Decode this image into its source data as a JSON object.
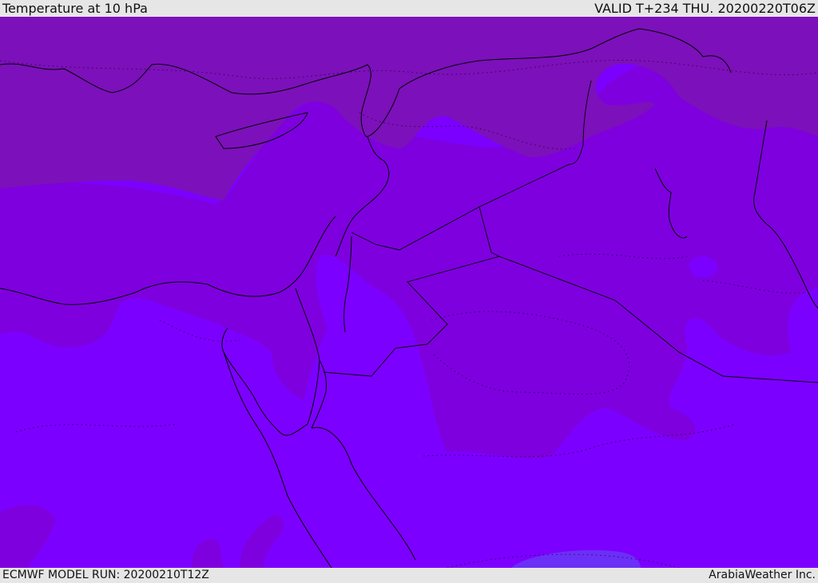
{
  "header": {
    "title": "Temperature at 10 hPa",
    "valid": "VALID T+234 THU. 20200220T06Z"
  },
  "footer": {
    "model_run": "ECMWF MODEL RUN: 20200210T12Z",
    "credit": "ArabiaWeather Inc."
  },
  "colors": {
    "band_north": "#7c10ba",
    "band_mid": "#7e00df",
    "band_south": "#7c00ff",
    "band_cool_patch": "#6b2ff7",
    "coastline": "#000000",
    "background": "#e6e6e6"
  }
}
